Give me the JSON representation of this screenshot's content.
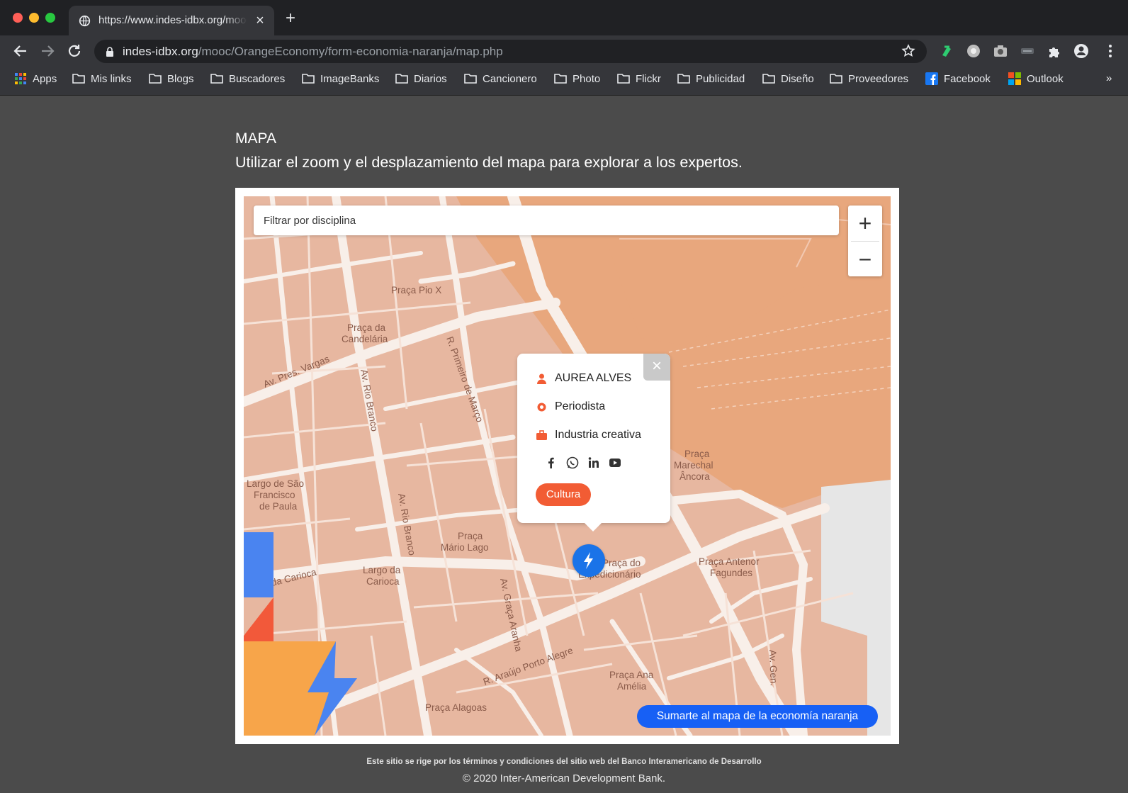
{
  "browser": {
    "tab_title": "https://www.indes-idbx.org/mooc/OrangeEconomy/form-economia-naranja/map.php",
    "url_host": "indes-idbx.org",
    "url_path": "/mooc/OrangeEconomy/form-economia-naranja/map.php",
    "bookmarks": [
      "Apps",
      "Mis links",
      "Blogs",
      "Buscadores",
      "ImageBanks",
      "Diarios",
      "Cancionero",
      "Photo",
      "Flickr",
      "Publicidad",
      "Diseño",
      "Proveedores",
      "Facebook",
      "Outlook"
    ],
    "bookmarks_more": "»"
  },
  "page": {
    "heading": "MAPA",
    "subheading": "Utilizar el zoom y el desplazamiento del mapa para explorar a los expertos."
  },
  "map": {
    "filter_placeholder": "Filtrar por disciplina",
    "zoom_in": "+",
    "zoom_out": "−",
    "labels": [
      "Praça Pio X",
      "Praça da",
      "Candelária",
      "Av. Pres. Vargas",
      "R. Primeiro de Março",
      "Av. Rio Branco",
      "Largo de São",
      "Francisco",
      "de Paula",
      "Praça",
      "Mário Lago",
      "Largo da",
      "Carioca",
      "Praça",
      "Marechal",
      "Âncora",
      "Praça do",
      "Expedicionário",
      "Praça Antenor",
      "Fagundes",
      "R. Araújo Porto Alegre",
      "Av. Graça Aranha",
      "Praça Ana",
      "Amélia",
      "Praça Alagoas",
      "da Carioca",
      "Av. Rio Branco",
      "Av. Gen."
    ],
    "popup": {
      "close": "×",
      "name": "AUREA ALVES",
      "role": "Periodista",
      "industry": "Industria creativa",
      "tag": "Cultura"
    },
    "cta": "Sumarte al mapa de la economía naranja"
  },
  "footer": {
    "terms": "Este sitio se rige por los términos y condiciones del sitio web del Banco Interamericano de Desarrollo",
    "copyright": "© 2020 Inter-American Development Bank."
  },
  "colors": {
    "accent_orange": "#f25c34",
    "cta_blue": "#1760f5",
    "pin_blue": "#1a73e8",
    "map_land": "#e7b7a0",
    "map_water": "#e8a77d"
  }
}
